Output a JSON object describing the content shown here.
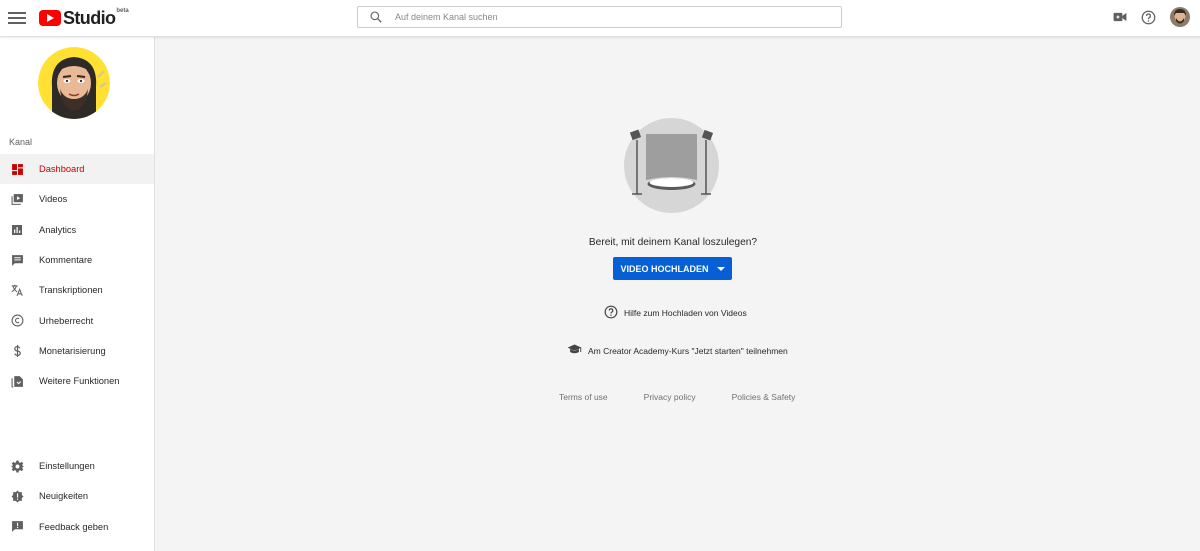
{
  "header": {
    "logo_text": "Studio",
    "logo_badge": "beta",
    "search_placeholder": "Auf deinem Kanal suchen"
  },
  "sidebar": {
    "section_label": "Kanal",
    "items": [
      {
        "label": "Dashboard",
        "icon": "dashboard-icon",
        "active": true
      },
      {
        "label": "Videos",
        "icon": "videos-icon"
      },
      {
        "label": "Analytics",
        "icon": "analytics-icon"
      },
      {
        "label": "Kommentare",
        "icon": "comments-icon"
      },
      {
        "label": "Transkriptionen",
        "icon": "translate-icon"
      },
      {
        "label": "Urheberrecht",
        "icon": "copyright-icon"
      },
      {
        "label": "Monetarisierung",
        "icon": "dollar-icon"
      },
      {
        "label": "Weitere Funktionen",
        "icon": "more-features-icon"
      }
    ],
    "bottom_items": [
      {
        "label": "Einstellungen",
        "icon": "gear-icon"
      },
      {
        "label": "Neuigkeiten",
        "icon": "news-icon"
      },
      {
        "label": "Feedback geben",
        "icon": "feedback-icon"
      }
    ]
  },
  "main": {
    "ready_text": "Bereit, mit deinem Kanal loszulegen?",
    "upload_button": "VIDEO HOCHLADEN",
    "help_link": "Hilfe zum Hochladen von Videos",
    "academy_link": "Am Creator Academy-Kurs \"Jetzt starten\" teilnehmen",
    "footer": {
      "terms": "Terms of use",
      "privacy": "Privacy policy",
      "policies": "Policies & Safety"
    }
  },
  "colors": {
    "brand_red": "#ff0000",
    "active_red": "#cc0000",
    "primary_blue": "#065fd4"
  }
}
